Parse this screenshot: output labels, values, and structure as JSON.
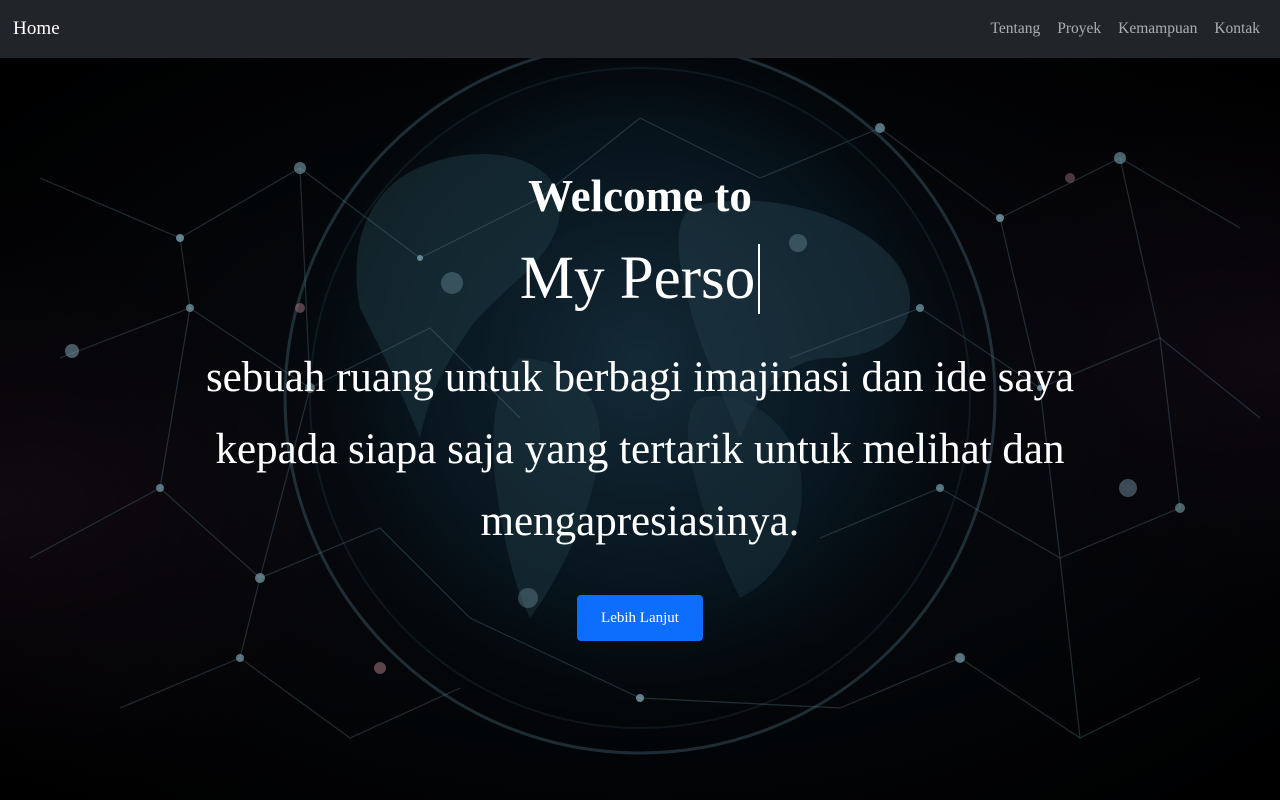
{
  "navbar": {
    "brand": "Home",
    "links": [
      "Tentang",
      "Proyek",
      "Kemampuan",
      "Kontak"
    ]
  },
  "hero": {
    "welcome": "Welcome to",
    "typed_text": "My Perso",
    "tagline": "sebuah ruang untuk berbagi imajinasi dan ide saya kepada siapa saja yang tertarik untuk melihat dan mengapresiasinya.",
    "cta_label": "Lebih Lanjut",
    "background_image": "network-globe-image"
  },
  "colors": {
    "navbar_bg": "#212529",
    "button_bg": "#0d6efd",
    "text": "#ffffff"
  }
}
